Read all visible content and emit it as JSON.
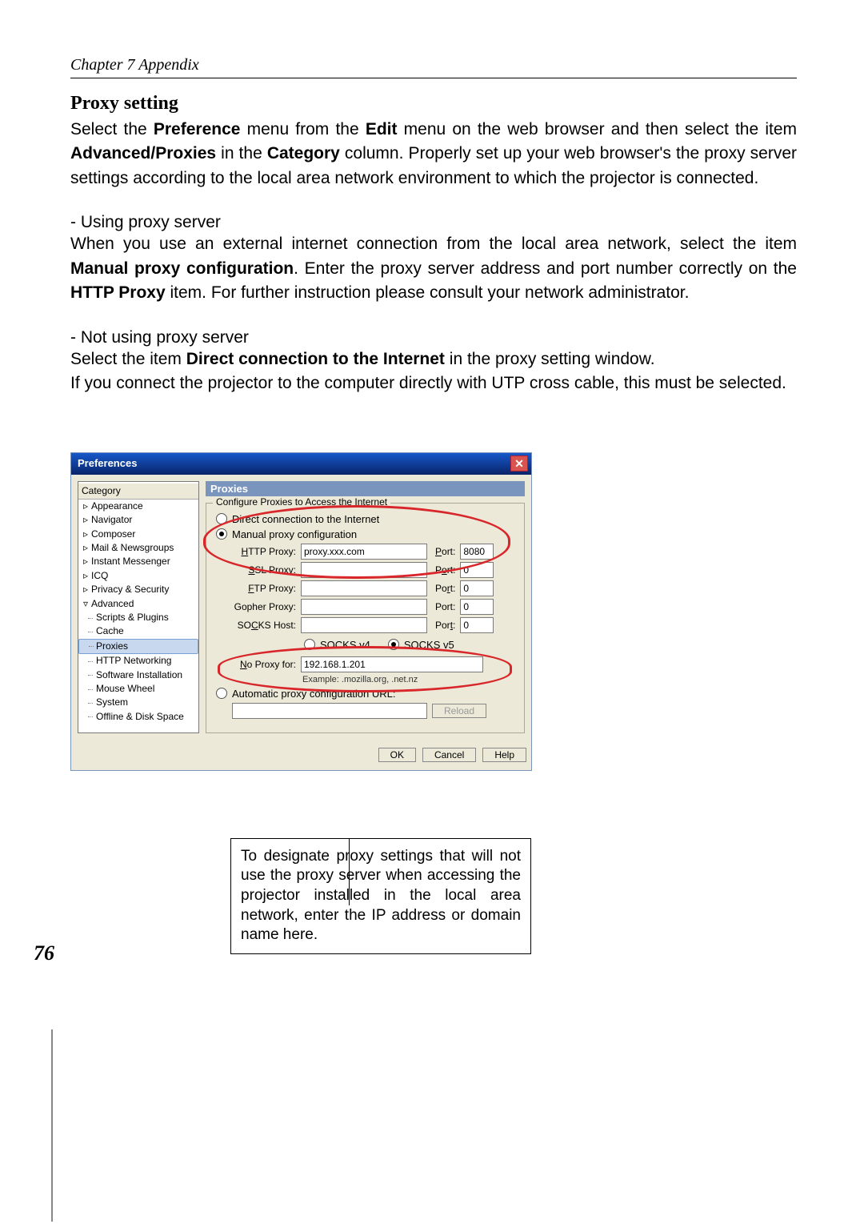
{
  "header": {
    "chapter": "Chapter 7 Appendix"
  },
  "section": {
    "title": "Proxy setting",
    "intro_pre": "Select the ",
    "intro_b1": "Preference",
    "intro_mid1": " menu from the ",
    "intro_b2": "Edit",
    "intro_mid2": " menu on the web browser and then select the item ",
    "intro_b3": "Advanced/Proxies",
    "intro_mid3": " in the ",
    "intro_b4": "Category",
    "intro_end": " column. Properly set up your web browser's the proxy server settings according to the local area network environment to which the projector is connected."
  },
  "using": {
    "head": "- Using proxy server",
    "p1_pre": "When you use an external internet connection from the local area network, select the item ",
    "p1_b1": "Manual proxy configuration",
    "p1_mid": ". Enter the proxy server address and port number correctly on the ",
    "p1_b2": "HTTP Proxy",
    "p1_end": " item. For further instruction please consult your network administrator."
  },
  "notusing": {
    "head": "- Not using proxy server",
    "p1_pre": "Select the item ",
    "p1_b1": "Direct connection to the Internet",
    "p1_end": " in the proxy setting window.",
    "p2": "If you connect the projector to the computer directly with UTP cross cable, this must be selected."
  },
  "window": {
    "title": "Preferences",
    "category_label": "Category",
    "tree": {
      "appearance": "Appearance",
      "navigator": "Navigator",
      "composer": "Composer",
      "mail": "Mail & Newsgroups",
      "im": "Instant Messenger",
      "icq": "ICQ",
      "privacy": "Privacy & Security",
      "advanced": "Advanced",
      "scripts": "Scripts & Plugins",
      "cache": "Cache",
      "proxies": "Proxies",
      "httpnet": "HTTP Networking",
      "softinst": "Software Installation",
      "mouse": "Mouse Wheel",
      "system": "System",
      "offline": "Offline & Disk Space"
    },
    "panel": {
      "title": "Proxies",
      "group": "Configure Proxies to Access the Internet",
      "opt_direct": "Direct connection to the Internet",
      "opt_manual": "Manual proxy configuration",
      "http_label": "HTTP Proxy:",
      "http_value": "proxy.xxx.com",
      "ssl_label": "SSL Proxy:",
      "ftp_label": "FTP Proxy:",
      "gopher_label": "Gopher Proxy:",
      "socks_label": "SOCKS Host:",
      "port_label": "Port:",
      "port_http": "8080",
      "port_ssl": "0",
      "port_ftp": "0",
      "port_gopher": "0",
      "port_socks": "0",
      "socks_v4": "SOCKS v4",
      "socks_v5": "SOCKS v5",
      "noproxy_label": "No Proxy for:",
      "noproxy_value": "192.168.1.201",
      "example": "Example: .mozilla.org, .net.nz",
      "opt_auto": "Automatic proxy configuration URL:",
      "reload": "Reload",
      "ok": "OK",
      "cancel": "Cancel",
      "help": "Help"
    }
  },
  "callout": "To designate proxy settings that will not use the proxy server when accessing the projector installed in the local area network, enter the IP address or domain name here.",
  "page_number": "76"
}
